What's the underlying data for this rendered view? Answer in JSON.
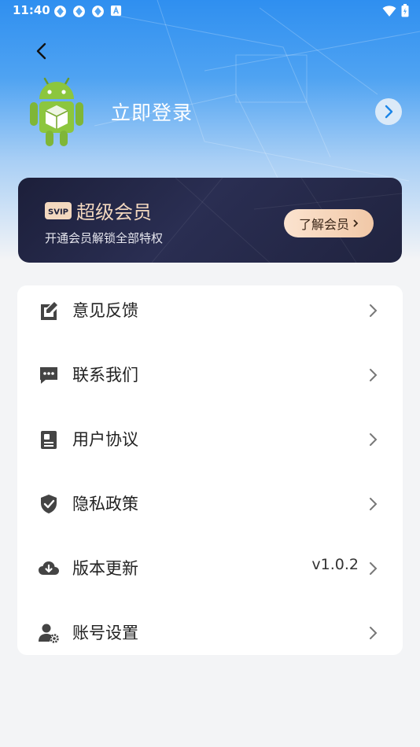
{
  "status_bar": {
    "time": "11:40"
  },
  "header": {
    "login_label": "立即登录"
  },
  "vip": {
    "badge": "SVIP",
    "title": "超级会员",
    "subtitle": "开通会员解锁全部特权",
    "button_label": "了解会员"
  },
  "menu": {
    "items": [
      {
        "label": "意见反馈",
        "icon": "feedback-edit-icon"
      },
      {
        "label": "联系我们",
        "icon": "chat-bubble-icon"
      },
      {
        "label": "用户协议",
        "icon": "document-icon"
      },
      {
        "label": "隐私政策",
        "icon": "shield-check-icon"
      },
      {
        "label": "版本更新",
        "icon": "cloud-download-icon",
        "value": "v1.0.2"
      },
      {
        "label": "账号设置",
        "icon": "user-settings-icon"
      }
    ]
  },
  "colors": {
    "accent": "#2f8ff0",
    "vip_gold": "#f3d8bf",
    "vip_dark": "#1c1f3a"
  }
}
